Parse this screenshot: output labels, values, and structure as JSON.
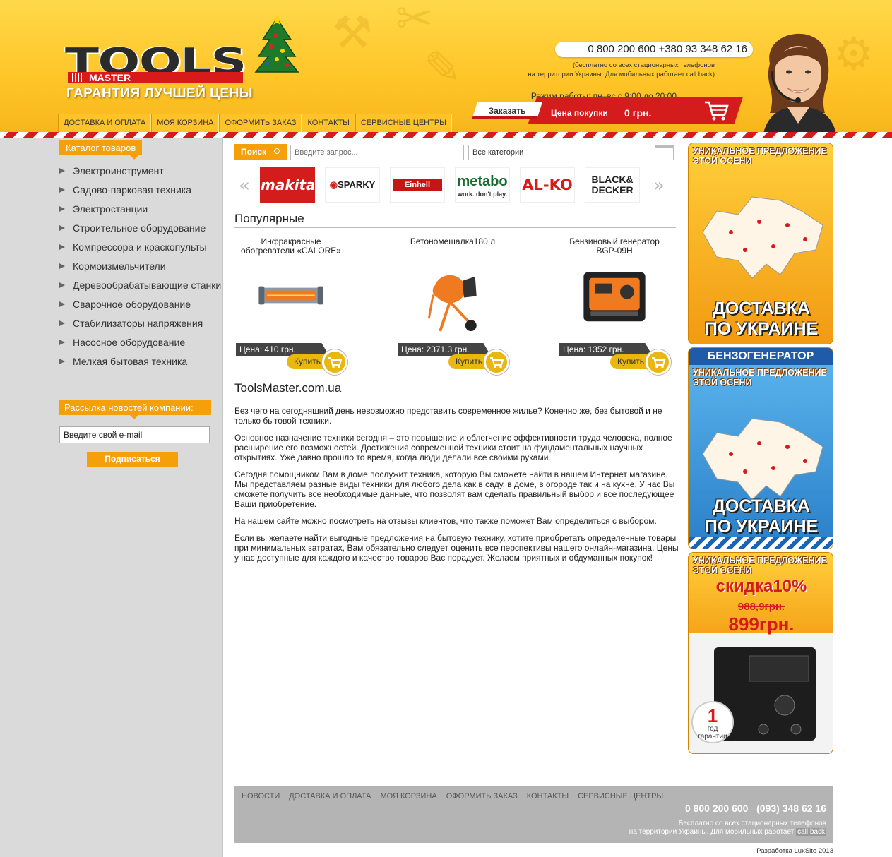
{
  "header": {
    "logo_tools": "TOOLS",
    "logo_master": "MASTER",
    "tagline": "ГАРАНТИЯ ЛУЧШЕЙ ЦЕНЫ",
    "phones": "0 800 200 600 +380 93 348 62 16",
    "phone_note_1": "(бесплатно со всех стационарных телефонов",
    "phone_note_2": "на территории Украины. Для мобильных работает call back)",
    "hours": "Режим работы: пн–вс с 9:00 до 20:00",
    "order_button": "Заказать",
    "cart_label": "Цена покупки",
    "cart_value": "0 грн."
  },
  "nav": [
    "ДОСТАВКА И ОПЛАТА",
    "МОЯ КОРЗИНА",
    "ОФОРМИТЬ ЗАКАЗ",
    "КОНТАКТЫ",
    "СЕРВИСНЫЕ ЦЕНТРЫ"
  ],
  "sidebar": {
    "catalog_title": "Каталог товаров",
    "catalog": [
      "Электроинструмент",
      "Садово-парковая техника",
      "Электростанции",
      "Строительное оборудование",
      "Компрессора и краскопульты",
      "Кормоизмельчители",
      "Деревообрабатывающие станки",
      "Сварочное оборудование",
      "Стабилизаторы напряжения",
      "Насосное оборудование",
      "Мелкая бытовая техника"
    ],
    "newsletter_title": "Рассылка новостей компании:",
    "email_placeholder": "Введите свой e-mail",
    "subscribe_label": "Подписаться"
  },
  "search": {
    "button_label": "Поиск",
    "placeholder": "Введите запрос...",
    "category_selected": "Все категории"
  },
  "brands": [
    "makita",
    "SPARKY",
    "Einhell",
    "metabo",
    "work. don't play.",
    "AL-KO",
    "BLACK&",
    "DECKER"
  ],
  "popular": {
    "title": "Популярные",
    "products": [
      {
        "name_1": "Инфракрасные",
        "name_2": "обогреватели «CALORE»",
        "price": "Цена: 410 грн.",
        "buy": "Купить"
      },
      {
        "name_1": "Бетономешалка180 л",
        "name_2": "",
        "price": "Цена: 2371.3 грн.",
        "buy": "Купить"
      },
      {
        "name_1": "Бензиновый генератор",
        "name_2": "BGP-09H",
        "price": "Цена: 1352 грн.",
        "buy": "Купить"
      }
    ]
  },
  "about": {
    "title": "ToolsMaster.com.ua",
    "paragraphs": [
      "Без чего на сегодняшний день невозможно представить современное жилье? Конечно же, без бытовой и не только бытовой техники.",
      "Основное назначение техники сегодня – это повышение и облегчение эффективности труда человека, полное расширение его возможностей. Достижения современной техники стоит на фундаментальных научных открытиях. Уже давно прошло то время, когда люди делали все своими руками.",
      "Сегодня помощником Вам в доме послужит техника, которую Вы сможете найти в нашем Интернет магазине. Мы представляем разные виды техники для любого дела как в саду, в доме, в огороде так и на кухне. У нас Вы сможете получить все необходимые данные, что позволят вам сделать правильный выбор и все последующее Ваши приобретение.",
      "На нашем сайте можно посмотреть на отзывы клиентов, что также поможет Вам определиться с выбором.",
      "Если вы желаете найти выгодные предложения на бытовую технику, хотите приобретать определенные товары при минимальных затратах, Вам обязательно следует оценить все перспективы нашего онлайн-магазина. Цены у нас доступные для каждого и качество товаров Вас порадует. Желаем приятных и обдуманных покупок!"
    ]
  },
  "banners": {
    "offer_1": "УНИКАЛЬНОЕ ПРЕДЛОЖЕНИЕ",
    "offer_2": "ЭТОЙ ОСЕНИ",
    "delivery_1": "ДОСТАВКА",
    "delivery_2": "ПО УКРАИНЕ",
    "generator": "БЕНЗОГЕНЕРАТОР",
    "discount": "скидка10%",
    "old_price": "988,9грн.",
    "new_price": "899грн.",
    "warranty_num": "1",
    "warranty_1": "год",
    "warranty_2": "гарантии"
  },
  "footer": {
    "nav": [
      "НОВОСТИ",
      "ДОСТАВКА И ОПЛАТА",
      "МОЯ КОРЗИНА",
      "ОФОРМИТЬ ЗАКАЗ",
      "КОНТАКТЫ",
      "СЕРВИСНЫЕ ЦЕНТРЫ"
    ],
    "phones": "0 800 200 600   (093) 348 62 16",
    "note_1": "Бесплатно со всех стационарных телефонов",
    "note_2": "на территории Украины. Для мобильных работает",
    "note_callback": "call back",
    "credits": "Разработка LuxSite 2013"
  }
}
